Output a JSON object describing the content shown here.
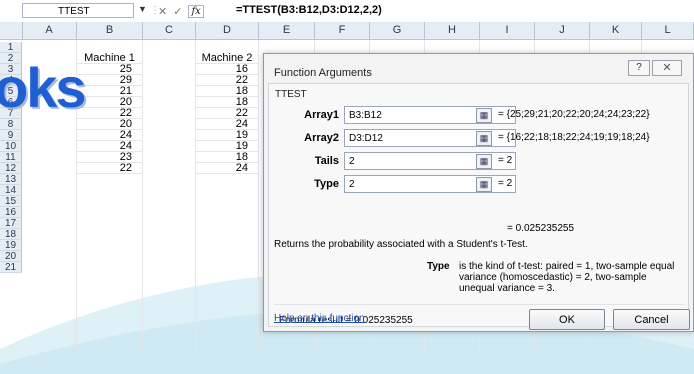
{
  "formula_bar": {
    "name_box": "TTEST",
    "formula": "=TTEST(B3:B12,D3:D12,2,2)",
    "fx_label": "fx"
  },
  "columns": [
    "A",
    "B",
    "C",
    "D",
    "E",
    "F",
    "G",
    "H",
    "I",
    "J",
    "K",
    "L"
  ],
  "row_numbers": [
    "1",
    "2",
    "3",
    "4",
    "5",
    "6",
    "7",
    "8",
    "9",
    "10",
    "11",
    "12",
    "13",
    "14",
    "15",
    "16",
    "17",
    "18",
    "19",
    "20",
    "21"
  ],
  "sheet": {
    "header_b": "Machine 1",
    "header_d": "Machine 2",
    "machine1": [
      "25",
      "29",
      "21",
      "20",
      "22",
      "20",
      "24",
      "24",
      "23",
      "22"
    ],
    "machine2": [
      "16",
      "22",
      "18",
      "18",
      "22",
      "24",
      "19",
      "19",
      "18",
      "24"
    ]
  },
  "watermark": "oks",
  "dialog": {
    "title": "Function Arguments",
    "help_btn": "?",
    "close_btn": "✕",
    "function_name": "TTEST",
    "args": [
      {
        "label": "Array1",
        "value": "B3:B12",
        "result": "=  {25;29;21;20;22;20;24;24;23;22}"
      },
      {
        "label": "Array2",
        "value": "D3:D12",
        "result": "=  {16;22;18;18;22;24;19;19;18;24}"
      },
      {
        "label": "Tails",
        "value": "2",
        "result": "=  2"
      },
      {
        "label": "Type",
        "value": "2",
        "result": "=  2"
      }
    ],
    "overall_result": "=  0.025235255",
    "description": "Returns the probability associated with a Student's t-Test.",
    "type_label": "Type",
    "type_description": "is the kind of t-test: paired = 1, two-sample equal variance (homoscedastic) = 2, two-sample unequal variance = 3.",
    "formula_result": "Formula result =  0.025235255",
    "help_link": "Help on this function",
    "ok": "OK",
    "cancel": "Cancel"
  },
  "colors": {
    "header_bg": "#e6ecf4",
    "watermark_blue": "#1f5fd1",
    "wave": "#d8eef6"
  }
}
